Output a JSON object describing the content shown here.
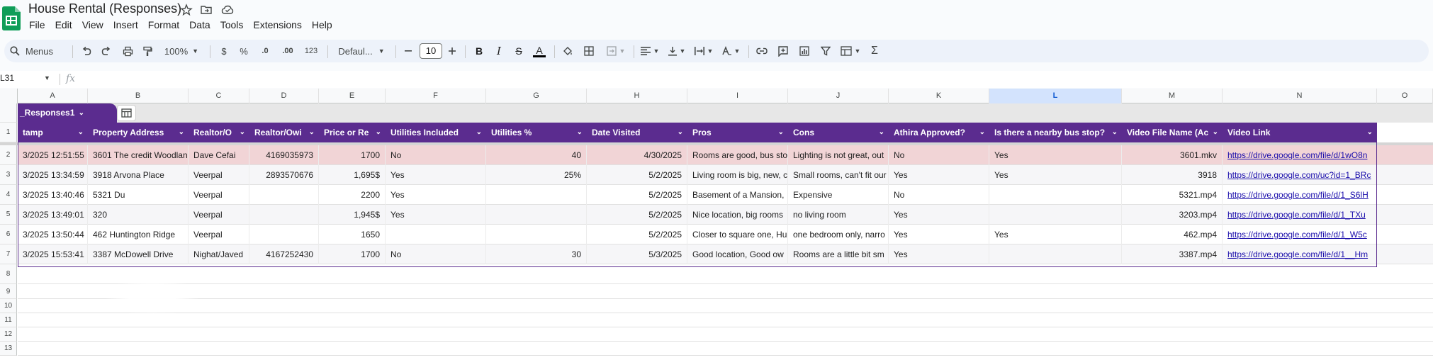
{
  "app": {
    "title": "House Rental (Responses)",
    "accent": "#5b2c8f",
    "highlight_row": "#f1d4d6"
  },
  "menu": [
    "File",
    "Edit",
    "View",
    "Insert",
    "Format",
    "Data",
    "Tools",
    "Extensions",
    "Help"
  ],
  "toolbar": {
    "search_label": "Menus",
    "zoom": "100%",
    "currency": "$",
    "percent": "%",
    "dec_decrease": ".0",
    "dec_increase": ".00",
    "number_format": "123",
    "font": "Defaul...",
    "font_size": "10"
  },
  "formula_bar": {
    "cell_ref": "L31",
    "fx": "fx",
    "value": ""
  },
  "columns": [
    "A",
    "B",
    "C",
    "D",
    "E",
    "F",
    "G",
    "H",
    "I",
    "J",
    "K",
    "L",
    "M",
    "N",
    "O"
  ],
  "selected_column": "L",
  "table": {
    "name": "_Responses1",
    "headers": [
      "tamp",
      "Property Address",
      "Realtor/O",
      "Realtor/Owi",
      "Price or Re",
      "Utilities Included",
      "Utilities %",
      "Date Visited",
      "Pros",
      "Cons",
      "Athira Approved?",
      "Is there a nearby bus stop?",
      "Video File Name (Ac",
      "Video Link"
    ]
  },
  "rows": [
    {
      "num": "2",
      "cells": [
        "3/2025 12:51:55",
        "3601 The credit Woodlan",
        "Dave Cefai",
        "4169035973",
        "1700",
        "No",
        "40",
        "4/30/2025",
        "Rooms are good, bus sto",
        "Lighting is not great, out",
        "No",
        "Yes",
        "3601.mkv",
        "https://drive.google.com/file/d/1wO8n"
      ]
    },
    {
      "num": "3",
      "cells": [
        "3/2025 13:34:59",
        "3918 Arvona Place",
        "Veerpal",
        "2893570676",
        "1,695$",
        "Yes",
        "25%",
        "5/2/2025",
        "Living room is big, new, c",
        "Small rooms, can't fit our",
        "Yes",
        "Yes",
        "3918",
        "https://drive.google.com/uc?id=1_BRc"
      ]
    },
    {
      "num": "4",
      "cells": [
        "3/2025 13:40:46",
        "5321 Du",
        "Veerpal",
        "",
        "2200",
        "Yes",
        "",
        "5/2/2025",
        "Basement of a Mansion,",
        "Expensive",
        "No",
        "",
        "5321.mp4",
        "https://drive.google.com/file/d/1_S6lH"
      ]
    },
    {
      "num": "5",
      "cells": [
        "3/2025 13:49:01",
        "320",
        "Veerpal",
        "",
        "1,945$",
        "Yes",
        "",
        "5/2/2025",
        "Nice location, big rooms",
        "no living room",
        "Yes",
        "",
        "3203.mp4",
        "https://drive.google.com/file/d/1_TXu"
      ]
    },
    {
      "num": "6",
      "cells": [
        "3/2025 13:50:44",
        "462 Huntington Ridge",
        "Veerpal",
        "",
        "1650",
        "",
        "",
        "5/2/2025",
        "Closer to square one, Hu",
        "one bedroom only, narro",
        "Yes",
        "Yes",
        "462.mp4",
        "https://drive.google.com/file/d/1_W5c"
      ]
    },
    {
      "num": "7",
      "cells": [
        "3/2025 15:53:41",
        "3387 McDowell Drive",
        "Nighat/Javed",
        "4167252430",
        "1700",
        "No",
        "30",
        "5/3/2025",
        "Good location, Good ow",
        "Rooms are a little bit sm",
        "Yes",
        "",
        "3387.mp4",
        "https://drive.google.com/file/d/1__Hm"
      ]
    }
  ],
  "empty_rows": [
    "8",
    "9",
    "10",
    "11",
    "12",
    "13"
  ]
}
